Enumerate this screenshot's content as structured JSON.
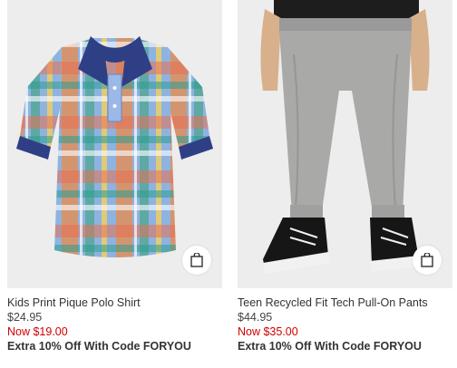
{
  "products": [
    {
      "name": "Kids Print Pique Polo Shirt",
      "original_price": "$24.95",
      "sale_price": "Now $19.00",
      "promo": "Extra 10% Off With Code FORYOU",
      "icon": "shopping-bag-icon"
    },
    {
      "name": "Teen Recycled Fit Tech Pull-On Pants",
      "original_price": "$44.95",
      "sale_price": "Now $35.00",
      "promo": "Extra 10% Off With Code FORYOU",
      "icon": "shopping-bag-icon"
    }
  ],
  "colors": {
    "sale_red": "#d00000",
    "image_bg": "#ededed"
  }
}
